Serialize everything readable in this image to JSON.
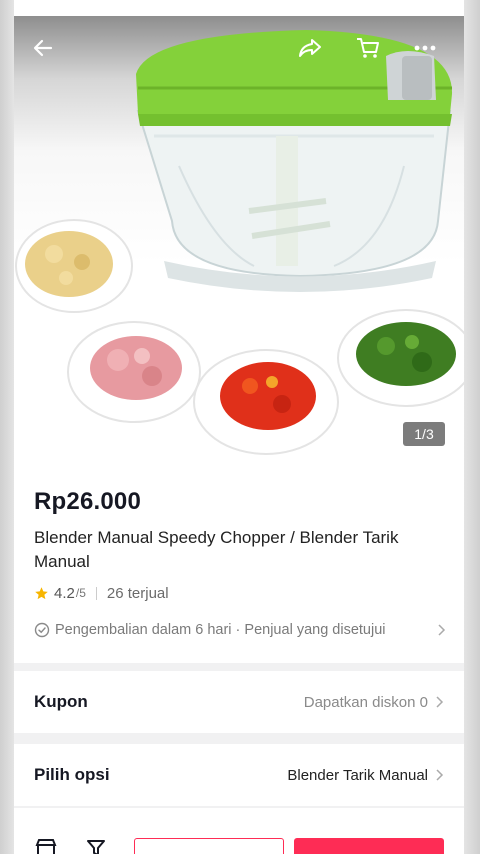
{
  "gallery": {
    "counter": "1/3",
    "icons": [
      "back-arrow-icon",
      "share-icon",
      "cart-icon",
      "more-icon"
    ]
  },
  "product": {
    "price": "Rp26.000",
    "title": "Blender Manual Speedy Chopper / Blender Tarik Manual",
    "rating": "4.2",
    "rating_max": "/5",
    "sold": "26 terjual",
    "return_policy": "Pengembalian dalam 6 hari · Penjual yang disetujui"
  },
  "coupon": {
    "label": "Kupon",
    "value": "Dapatkan diskon 0"
  },
  "options": {
    "label": "Pilih opsi",
    "value": "Blender Tarik Manual"
  },
  "colors": {
    "accent": "#fe2c55",
    "star": "#f7b500",
    "lid_green": "#7ccf2e"
  }
}
